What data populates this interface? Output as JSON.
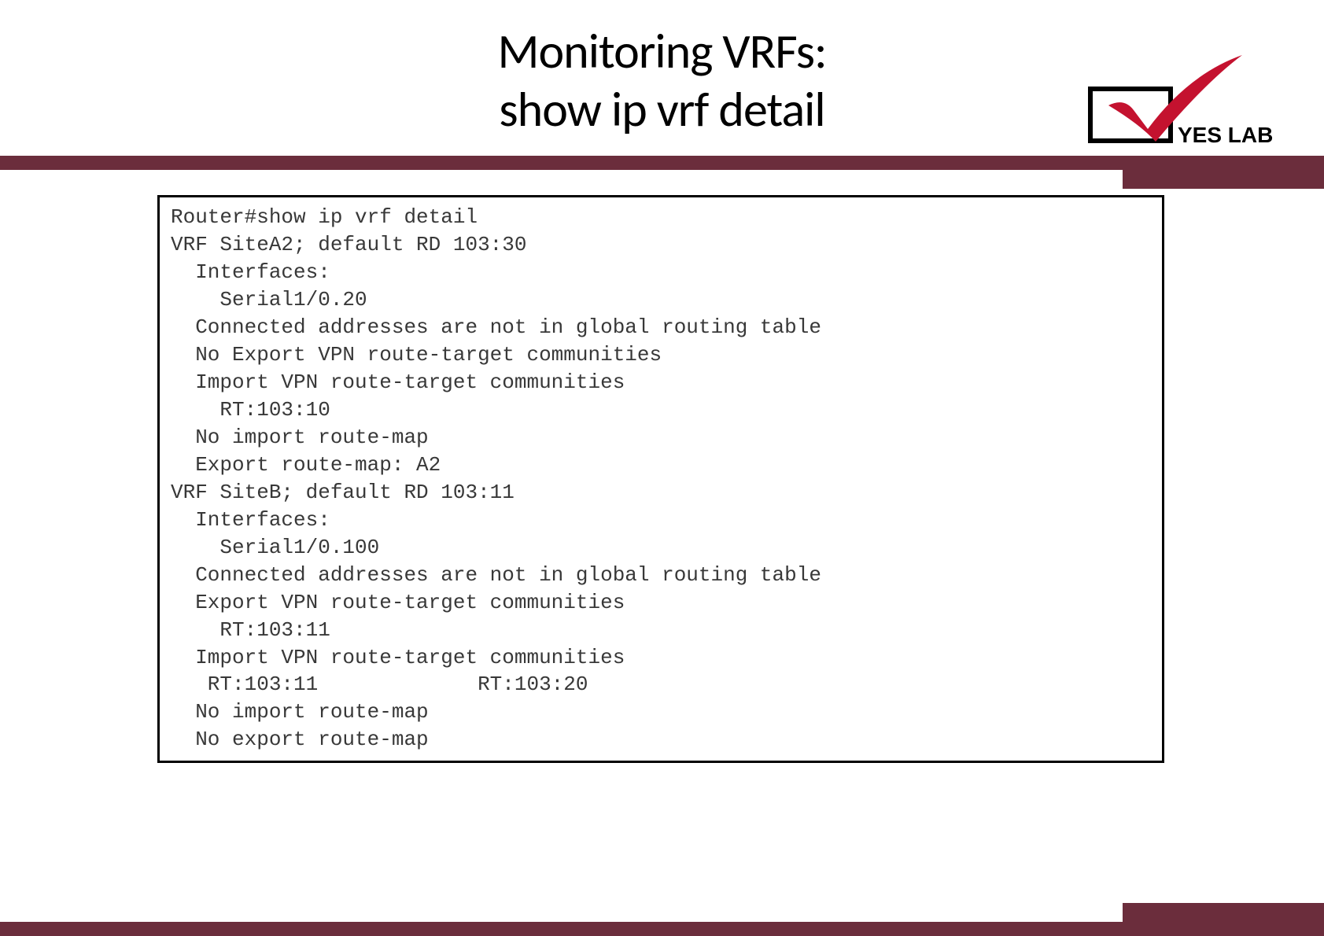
{
  "title": {
    "line1": "Monitoring VRFs:",
    "line2": "show ip vrf detail"
  },
  "logo": {
    "text": "YES LAB"
  },
  "code": {
    "l01": "Router#show ip vrf detail",
    "l02": "VRF SiteA2; default RD 103:30",
    "l03": "  Interfaces:",
    "l04": "    Serial1/0.20",
    "l05": "  Connected addresses are not in global routing table",
    "l06": "  No Export VPN route-target communities",
    "l07": "  Import VPN route-target communities",
    "l08": "    RT:103:10",
    "l09": "  No import route-map",
    "l10": "  Export route-map: A2",
    "l11": "VRF SiteB; default RD 103:11",
    "l12": "  Interfaces:",
    "l13": "    Serial1/0.100",
    "l14": "  Connected addresses are not in global routing table",
    "l15": "  Export VPN route-target communities",
    "l16": "    RT:103:11",
    "l17": "  Import VPN route-target communities",
    "l18": "   RT:103:11             RT:103:20",
    "l19": "  No import route-map",
    "l20": "  No export route-map"
  }
}
